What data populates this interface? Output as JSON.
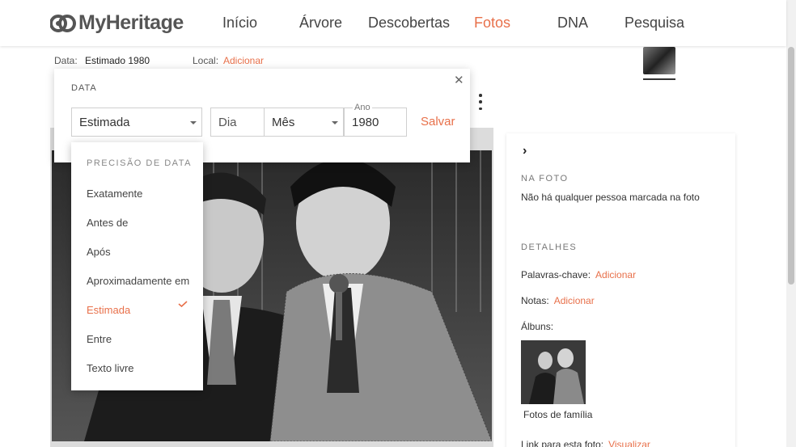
{
  "app": {
    "logo_text": "MyHeritage"
  },
  "nav": {
    "items": [
      {
        "label": "Início"
      },
      {
        "label": "Árvore"
      },
      {
        "label": "Descobertas"
      },
      {
        "label": "Fotos"
      },
      {
        "label": "DNA"
      },
      {
        "label": "Pesquisa"
      }
    ],
    "active": "Fotos"
  },
  "photo_meta": {
    "date_label": "Data:",
    "date_value": "Estimado 1980",
    "place_label": "Local:",
    "place_link": "Adicionar"
  },
  "date_editor": {
    "title": "DATA",
    "precision_value": "Estimada",
    "day_placeholder": "Dia",
    "month_value": "Mês",
    "year_label": "Ano",
    "year_value": "1980",
    "save_label": "Salvar"
  },
  "precision_menu": {
    "heading": "PRECISÃO DE DATA",
    "options": [
      {
        "label": "Exatamente"
      },
      {
        "label": "Antes de"
      },
      {
        "label": "Após"
      },
      {
        "label": "Aproximadamente em"
      },
      {
        "label": "Estimada"
      },
      {
        "label": "Entre"
      },
      {
        "label": "Texto livre"
      }
    ],
    "selected": "Estimada"
  },
  "side_panel": {
    "in_photo_heading": "NA FOTO",
    "in_photo_text": "Não há qualquer pessoa marcada na foto",
    "details_heading": "DETALHES",
    "keywords_label": "Palavras-chave:",
    "keywords_link": "Adicionar",
    "notes_label": "Notas:",
    "notes_link": "Adicionar",
    "albums_label": "Álbuns:",
    "album_caption": "Fotos de família",
    "link_label": "Link para esta foto:",
    "link_action": "Visualizar"
  },
  "colors": {
    "accent": "#e8704a",
    "text": "#333333",
    "muted": "#777777"
  }
}
